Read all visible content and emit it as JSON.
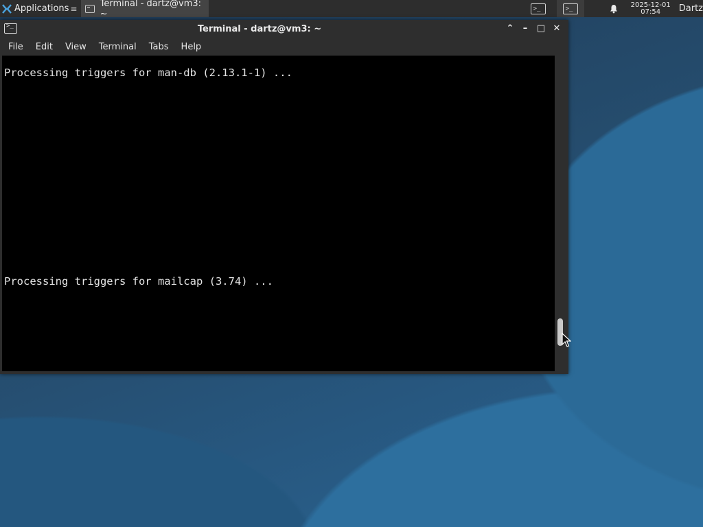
{
  "panel": {
    "applications_label": "Applications",
    "task_title": "Terminal - dartz@vm3: ~",
    "workspace1_glyph": ">_",
    "workspace2_glyph": ">_",
    "date": "2025-12-01",
    "time": "07:54",
    "user": "Dartz"
  },
  "window": {
    "title": "Terminal - dartz@vm3: ~",
    "buttons": {
      "up": "⌃",
      "minimize": "–",
      "maximize": "□",
      "close": "✕"
    },
    "menu": [
      "File",
      "Edit",
      "View",
      "Terminal",
      "Tabs",
      "Help"
    ]
  },
  "terminal": {
    "lines": [
      "Processing triggers for man-db (2.13.1-1) ...",
      "Processing triggers for mailcap (3.74) ..."
    ]
  },
  "colors": {
    "panel_bg": "#2d2d2d",
    "window_bg": "#2e2e2e",
    "terminal_bg": "#000000",
    "terminal_fg": "#e5e5e5"
  }
}
